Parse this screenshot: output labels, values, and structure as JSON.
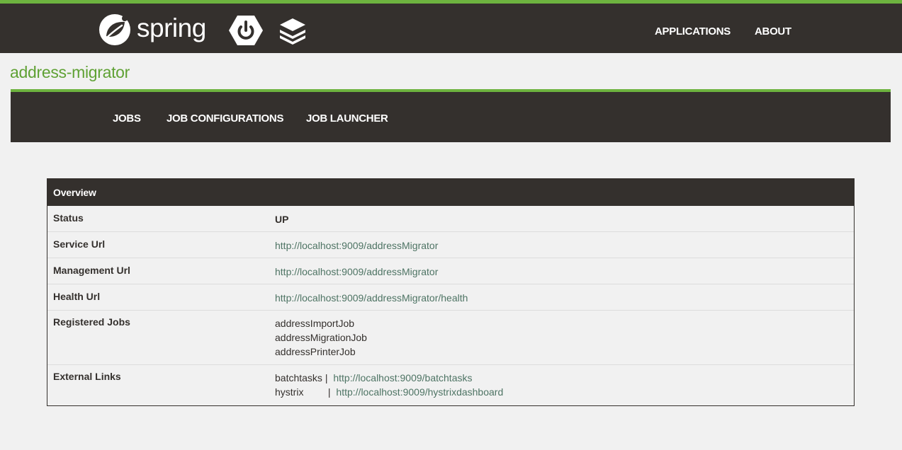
{
  "header": {
    "logo_text": "spring",
    "nav": [
      "APPLICATIONS",
      "ABOUT"
    ]
  },
  "app": {
    "title": "address-migrator",
    "tabs": [
      "JOBS",
      "JOB CONFIGURATIONS",
      "JOB LAUNCHER"
    ]
  },
  "overview": {
    "title": "Overview",
    "status_label": "Status",
    "status_value": "UP",
    "service_url_label": "Service Url",
    "service_url": "http://localhost:9009/addressMigrator",
    "management_url_label": "Management Url",
    "management_url": "http://localhost:9009/addressMigrator",
    "health_url_label": "Health Url",
    "health_url": "http://localhost:9009/addressMigrator/health",
    "registered_jobs_label": "Registered Jobs",
    "registered_jobs": [
      "addressImportJob",
      "addressMigrationJob",
      "addressPrinterJob"
    ],
    "external_links_label": "External Links",
    "external_links": [
      {
        "name": "batchtasks",
        "url": "http://localhost:9009/batchtasks"
      },
      {
        "name": "hystrix",
        "url": "http://localhost:9009/hystrixdashboard"
      }
    ],
    "separator": "|"
  },
  "colors": {
    "dark": "#34302d",
    "spring_green": "#6db33f",
    "title_green": "#5fa134",
    "status_green": "#3aa617",
    "link": "#4e7464",
    "background": "#f1f1f1"
  },
  "icons": [
    "spring-leaf-icon",
    "spring-boot-power-icon",
    "stack-layers-icon"
  ]
}
